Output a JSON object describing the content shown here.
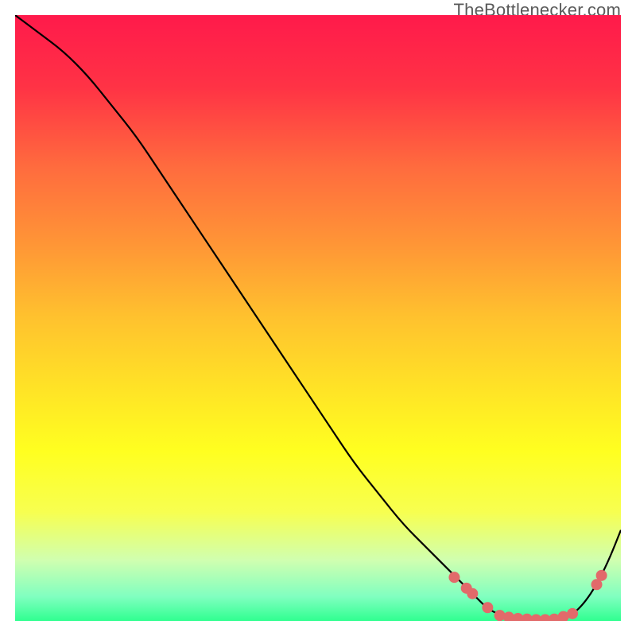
{
  "watermark": "TheBottlenecker.com",
  "chart_data": {
    "type": "line",
    "title": "",
    "xlabel": "",
    "ylabel": "",
    "xlim": [
      0,
      100
    ],
    "ylim": [
      0,
      100
    ],
    "background_gradient": {
      "stops": [
        {
          "offset": 0.0,
          "color": "#ff1a4b"
        },
        {
          "offset": 0.12,
          "color": "#ff3345"
        },
        {
          "offset": 0.25,
          "color": "#ff6b3e"
        },
        {
          "offset": 0.38,
          "color": "#ff9636"
        },
        {
          "offset": 0.5,
          "color": "#ffc22e"
        },
        {
          "offset": 0.62,
          "color": "#ffe426"
        },
        {
          "offset": 0.72,
          "color": "#ffff20"
        },
        {
          "offset": 0.82,
          "color": "#f7ff50"
        },
        {
          "offset": 0.9,
          "color": "#d0ffb0"
        },
        {
          "offset": 0.96,
          "color": "#80ffc0"
        },
        {
          "offset": 1.0,
          "color": "#30ff90"
        }
      ]
    },
    "series": [
      {
        "name": "bottleneck-curve",
        "x": [
          0,
          4,
          8,
          12,
          16,
          20,
          24,
          28,
          32,
          36,
          40,
          44,
          48,
          52,
          56,
          60,
          64,
          68,
          72,
          74,
          76,
          78,
          80,
          82,
          84,
          86,
          88,
          90,
          92,
          94,
          96,
          98,
          100
        ],
        "y": [
          100,
          97,
          94,
          90,
          85,
          80,
          74,
          68,
          62,
          56,
          50,
          44,
          38,
          32,
          26,
          21,
          16,
          12,
          8,
          6,
          4,
          2,
          1,
          0.5,
          0.3,
          0.2,
          0.2,
          0.5,
          1,
          3,
          6,
          10,
          15
        ]
      }
    ],
    "markers": {
      "name": "highlight-points",
      "color": "#e26a6a",
      "radius": 7,
      "points": [
        {
          "x": 72.5,
          "y": 7.2
        },
        {
          "x": 74.5,
          "y": 5.4
        },
        {
          "x": 75.5,
          "y": 4.5
        },
        {
          "x": 78.0,
          "y": 2.2
        },
        {
          "x": 80.0,
          "y": 0.9
        },
        {
          "x": 81.5,
          "y": 0.6
        },
        {
          "x": 83.0,
          "y": 0.4
        },
        {
          "x": 84.5,
          "y": 0.3
        },
        {
          "x": 86.0,
          "y": 0.2
        },
        {
          "x": 87.5,
          "y": 0.2
        },
        {
          "x": 89.0,
          "y": 0.3
        },
        {
          "x": 90.5,
          "y": 0.7
        },
        {
          "x": 92.0,
          "y": 1.2
        },
        {
          "x": 96.0,
          "y": 6.0
        },
        {
          "x": 96.8,
          "y": 7.5
        }
      ]
    }
  }
}
